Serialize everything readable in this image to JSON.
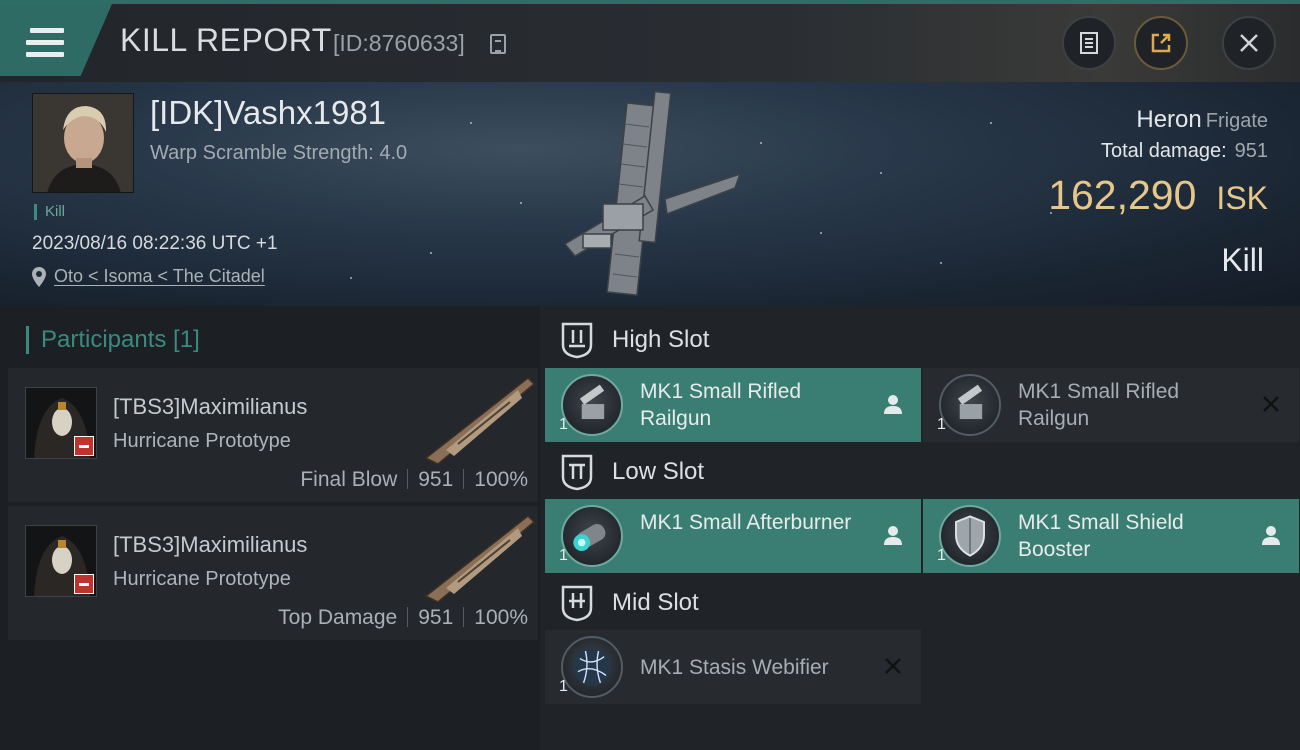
{
  "header": {
    "title": "KILL REPORT",
    "report_id": "[ID:8760633]",
    "colors": {
      "accent": "#2f6e67",
      "isk": "#e7c68a"
    }
  },
  "victim": {
    "pilot_name": "[IDK]Vashx1981",
    "warp_scramble": "Warp Scramble Strength: 4.0",
    "kill_tag": "Kill",
    "datetime": "2023/08/16 08:22:36 UTC +1",
    "location": "Oto < Isoma < The Citadel",
    "ship_name": "Heron",
    "ship_class": "Frigate",
    "total_damage_label": "Total damage:",
    "total_damage": "951",
    "isk_value": "162,290",
    "isk_unit": "ISK",
    "result": "Kill"
  },
  "participants": {
    "title": "Participants [1]",
    "rows": [
      {
        "name": "[TBS3]Maximilianus",
        "ship": "Hurricane Prototype",
        "role": "Final Blow",
        "damage": "951",
        "percent": "100%"
      },
      {
        "name": "[TBS3]Maximilianus",
        "ship": "Hurricane Prototype",
        "role": "Top Damage",
        "damage": "951",
        "percent": "100%"
      }
    ]
  },
  "slots": [
    {
      "title": "High Slot",
      "modules": [
        {
          "name": "MK1 Small Rifled Railgun",
          "qty": "1",
          "status": "dropped",
          "icon": "railgun-icon"
        },
        {
          "name": "MK1 Small Rifled Railgun",
          "qty": "1",
          "status": "destroyed",
          "icon": "railgun-icon"
        }
      ]
    },
    {
      "title": "Low Slot",
      "modules": [
        {
          "name": "MK1 Small Afterburner",
          "qty": "1",
          "status": "dropped",
          "icon": "afterburner-icon"
        },
        {
          "name": "MK1 Small Shield Booster",
          "qty": "1",
          "status": "dropped",
          "icon": "shield-booster-icon"
        }
      ]
    },
    {
      "title": "Mid Slot",
      "modules": [
        {
          "name": "MK1 Stasis Webifier",
          "qty": "1",
          "status": "destroyed",
          "icon": "stasis-webifier-icon"
        }
      ]
    }
  ]
}
